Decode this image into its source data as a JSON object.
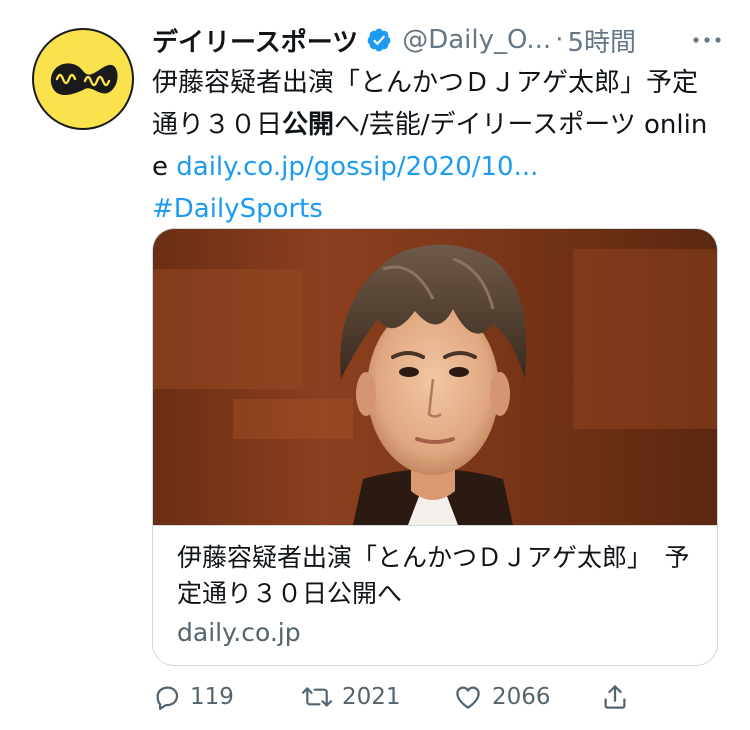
{
  "author": {
    "display_name": "デイリースポーツ",
    "handle": "@Daily_O...",
    "separator": "·",
    "time": "5時間",
    "avatar_icon": "daily-sports-logo",
    "verified_icon": "verified-badge-icon",
    "more_icon": "more-dots-icon"
  },
  "tweet": {
    "text_part1": "伊藤容疑者出演「とんかつＤＪアゲ太郎」予定通り３０日",
    "text_bold": "公開",
    "text_part2": "へ/芸能/デイリースポーツ online ",
    "link": "daily.co.jp/gossip/2020/10...",
    "hashtag": "#DailySports"
  },
  "card": {
    "title": "伊藤容疑者出演「とんかつＤＪアゲ太郎」　予定通り３０日公開へ",
    "domain": "daily.co.jp",
    "image_icon": "article-photo"
  },
  "actions": {
    "reply_count": "119",
    "retweet_count": "2021",
    "like_count": "2066",
    "reply_icon": "reply-icon",
    "retweet_icon": "retweet-icon",
    "like_icon": "heart-icon",
    "share_icon": "share-icon"
  },
  "colors": {
    "link": "#1d9bf0",
    "secondary_text": "#657786",
    "verified": "#1d9bf0",
    "avatar_bg": "#f9e24b"
  }
}
